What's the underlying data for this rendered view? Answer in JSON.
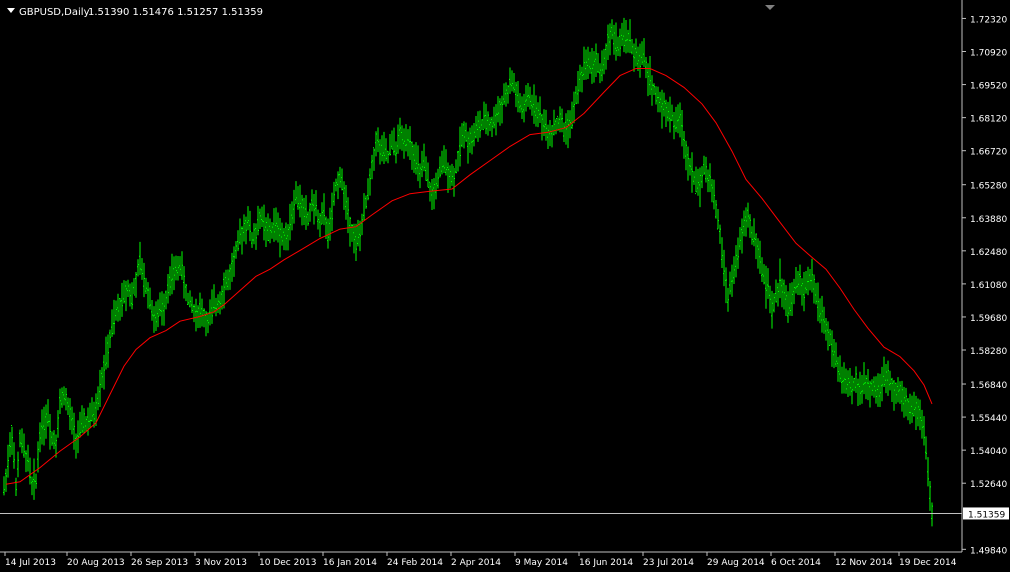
{
  "header": {
    "symbol_label": "GBPUSD,Daily",
    "ohlc_text": "1.51390 1.51476 1.51257 1.51359"
  },
  "colors": {
    "background": "#000000",
    "bars": "#00ff00",
    "moving_average": "#ff0000",
    "axis": "#c0c0c0",
    "text": "#ffffff",
    "price_line": "#c0c0c0"
  },
  "chart_data": {
    "type": "line",
    "title": "GBPUSD,Daily",
    "xlabel": "",
    "ylabel": "",
    "ylim": [
      1.496,
      1.7272
    ],
    "grid": false,
    "current_price": "1.51359",
    "y_ticks": [
      "1.72320",
      "1.70920",
      "1.69520",
      "1.68120",
      "1.66720",
      "1.65280",
      "1.63880",
      "1.62480",
      "1.61080",
      "1.59680",
      "1.58280",
      "1.56840",
      "1.55440",
      "1.54040",
      "1.52640",
      "1.49840"
    ],
    "x_ticks": [
      "14 Jul 2013",
      "20 Aug 2013",
      "26 Sep 2013",
      "3 Nov 2013",
      "10 Dec 2013",
      "16 Jan 2014",
      "24 Feb 2014",
      "2 Apr 2014",
      "9 May 2014",
      "16 Jun 2014",
      "23 Jul 2014",
      "29 Aug 2014",
      "6 Oct 2014",
      "12 Nov 2014",
      "19 Dec 2014"
    ],
    "series": [
      {
        "style": "ohlc-bars",
        "x": [
          "14 Jul 2013",
          "20 Aug 2013",
          "26 Sep 2013",
          "3 Nov 2013",
          "10 Dec 2013",
          "16 Jan 2014",
          "24 Feb 2014",
          "2 Apr 2014",
          "9 May 2014",
          "16 Jun 2014",
          "23 Jul 2014",
          "29 Aug 2014",
          "6 Oct 2014",
          "12 Nov 2014",
          "19 Dec 2014"
        ],
        "values": [
          1.512,
          1.552,
          1.56,
          1.585,
          1.61,
          1.628,
          1.64,
          1.66,
          1.672,
          1.715,
          1.7,
          1.62,
          1.612,
          1.571,
          1.514
        ],
        "points": [
          [
            0,
            1.512
          ],
          [
            4,
            1.524
          ],
          [
            8,
            1.536
          ],
          [
            12,
            1.548
          ],
          [
            16,
            1.524
          ],
          [
            20,
            1.545
          ],
          [
            24,
            1.54
          ],
          [
            28,
            1.536
          ],
          [
            32,
            1.525
          ],
          [
            36,
            1.528
          ],
          [
            40,
            1.548
          ],
          [
            44,
            1.552
          ],
          [
            48,
            1.555
          ],
          [
            52,
            1.546
          ],
          [
            56,
            1.545
          ],
          [
            60,
            1.56
          ],
          [
            64,
            1.565
          ],
          [
            68,
            1.558
          ],
          [
            72,
            1.552
          ],
          [
            76,
            1.545
          ],
          [
            80,
            1.548
          ],
          [
            84,
            1.553
          ],
          [
            88,
            1.552
          ],
          [
            92,
            1.555
          ],
          [
            96,
            1.558
          ],
          [
            100,
            1.568
          ],
          [
            104,
            1.575
          ],
          [
            108,
            1.583
          ],
          [
            112,
            1.592
          ],
          [
            116,
            1.598
          ],
          [
            120,
            1.602
          ],
          [
            124,
            1.606
          ],
          [
            128,
            1.61
          ],
          [
            132,
            1.605
          ],
          [
            136,
            1.612
          ],
          [
            140,
            1.62
          ],
          [
            144,
            1.612
          ],
          [
            148,
            1.608
          ],
          [
            152,
            1.6
          ],
          [
            156,
            1.595
          ],
          [
            160,
            1.6
          ],
          [
            164,
            1.602
          ],
          [
            168,
            1.61
          ],
          [
            172,
            1.614
          ],
          [
            176,
            1.616
          ],
          [
            180,
            1.62
          ],
          [
            184,
            1.612
          ],
          [
            188,
            1.604
          ],
          [
            192,
            1.602
          ],
          [
            196,
            1.598
          ],
          [
            200,
            1.6
          ],
          [
            204,
            1.597
          ],
          [
            208,
            1.594
          ],
          [
            212,
            1.6
          ],
          [
            216,
            1.602
          ],
          [
            220,
            1.605
          ],
          [
            224,
            1.61
          ],
          [
            228,
            1.612
          ],
          [
            232,
            1.618
          ],
          [
            236,
            1.624
          ],
          [
            240,
            1.63
          ],
          [
            244,
            1.635
          ],
          [
            248,
            1.638
          ],
          [
            252,
            1.63
          ],
          [
            256,
            1.632
          ],
          [
            260,
            1.64
          ],
          [
            264,
            1.636
          ],
          [
            268,
            1.632
          ],
          [
            272,
            1.634
          ],
          [
            276,
            1.636
          ],
          [
            280,
            1.632
          ],
          [
            284,
            1.63
          ],
          [
            288,
            1.634
          ],
          [
            292,
            1.64
          ],
          [
            296,
            1.648
          ],
          [
            300,
            1.645
          ],
          [
            304,
            1.642
          ],
          [
            308,
            1.638
          ],
          [
            312,
            1.646
          ],
          [
            316,
            1.642
          ],
          [
            320,
            1.637
          ],
          [
            324,
            1.64
          ],
          [
            328,
            1.632
          ],
          [
            332,
            1.64
          ],
          [
            336,
            1.652
          ],
          [
            340,
            1.657
          ],
          [
            344,
            1.65
          ],
          [
            348,
            1.64
          ],
          [
            352,
            1.634
          ],
          [
            356,
            1.628
          ],
          [
            360,
            1.632
          ],
          [
            364,
            1.64
          ],
          [
            368,
            1.65
          ],
          [
            372,
            1.66
          ],
          [
            376,
            1.672
          ],
          [
            380,
            1.668
          ],
          [
            384,
            1.666
          ],
          [
            388,
            1.665
          ],
          [
            392,
            1.67
          ],
          [
            396,
            1.668
          ],
          [
            400,
            1.674
          ],
          [
            404,
            1.67
          ],
          [
            408,
            1.674
          ],
          [
            412,
            1.668
          ],
          [
            416,
            1.662
          ],
          [
            420,
            1.658
          ],
          [
            424,
            1.661
          ],
          [
            428,
            1.654
          ],
          [
            432,
            1.648
          ],
          [
            436,
            1.652
          ],
          [
            440,
            1.658
          ],
          [
            444,
            1.662
          ],
          [
            448,
            1.66
          ],
          [
            452,
            1.655
          ],
          [
            456,
            1.66
          ],
          [
            460,
            1.668
          ],
          [
            464,
            1.676
          ],
          [
            468,
            1.672
          ],
          [
            472,
            1.672
          ],
          [
            476,
            1.676
          ],
          [
            480,
            1.678
          ],
          [
            484,
            1.679
          ],
          [
            488,
            1.68
          ],
          [
            492,
            1.678
          ],
          [
            496,
            1.682
          ],
          [
            500,
            1.685
          ],
          [
            504,
            1.69
          ],
          [
            508,
            1.692
          ],
          [
            512,
            1.697
          ],
          [
            516,
            1.692
          ],
          [
            520,
            1.686
          ],
          [
            524,
            1.684
          ],
          [
            528,
            1.69
          ],
          [
            532,
            1.688
          ],
          [
            536,
            1.685
          ],
          [
            540,
            1.682
          ],
          [
            544,
            1.678
          ],
          [
            548,
            1.675
          ],
          [
            552,
            1.676
          ],
          [
            556,
            1.678
          ],
          [
            560,
            1.68
          ],
          [
            564,
            1.676
          ],
          [
            568,
            1.678
          ],
          [
            572,
            1.68
          ],
          [
            576,
            1.69
          ],
          [
            580,
            1.698
          ],
          [
            584,
            1.702
          ],
          [
            588,
            1.706
          ],
          [
            592,
            1.703
          ],
          [
            596,
            1.706
          ],
          [
            600,
            1.7
          ],
          [
            604,
            1.704
          ],
          [
            608,
            1.714
          ],
          [
            612,
            1.717
          ],
          [
            616,
            1.712
          ],
          [
            620,
            1.713
          ],
          [
            624,
            1.714
          ],
          [
            628,
            1.716
          ],
          [
            632,
            1.71
          ],
          [
            636,
            1.708
          ],
          [
            640,
            1.705
          ],
          [
            644,
            1.707
          ],
          [
            648,
            1.698
          ],
          [
            652,
            1.696
          ],
          [
            656,
            1.69
          ],
          [
            660,
            1.688
          ],
          [
            664,
            1.686
          ],
          [
            668,
            1.684
          ],
          [
            672,
            1.682
          ],
          [
            676,
            1.678
          ],
          [
            680,
            1.682
          ],
          [
            684,
            1.67
          ],
          [
            688,
            1.664
          ],
          [
            692,
            1.66
          ],
          [
            696,
            1.652
          ],
          [
            700,
            1.654
          ],
          [
            704,
            1.66
          ],
          [
            708,
            1.656
          ],
          [
            712,
            1.652
          ],
          [
            716,
            1.642
          ],
          [
            720,
            1.632
          ],
          [
            724,
            1.616
          ],
          [
            728,
            1.606
          ],
          [
            732,
            1.612
          ],
          [
            736,
            1.62
          ],
          [
            740,
            1.628
          ],
          [
            744,
            1.635
          ],
          [
            748,
            1.64
          ],
          [
            752,
            1.632
          ],
          [
            756,
            1.63
          ],
          [
            760,
            1.62
          ],
          [
            764,
            1.614
          ],
          [
            768,
            1.608
          ],
          [
            772,
            1.6
          ],
          [
            776,
            1.605
          ],
          [
            780,
            1.612
          ],
          [
            784,
            1.608
          ],
          [
            788,
            1.6
          ],
          [
            792,
            1.605
          ],
          [
            796,
            1.61
          ],
          [
            800,
            1.612
          ],
          [
            804,
            1.608
          ],
          [
            808,
            1.61
          ],
          [
            812,
            1.614
          ],
          [
            816,
            1.606
          ],
          [
            820,
            1.6
          ],
          [
            824,
            1.596
          ],
          [
            828,
            1.59
          ],
          [
            832,
            1.584
          ],
          [
            836,
            1.578
          ],
          [
            840,
            1.573
          ],
          [
            844,
            1.57
          ],
          [
            848,
            1.568
          ],
          [
            852,
            1.566
          ],
          [
            856,
            1.57
          ],
          [
            860,
            1.566
          ],
          [
            864,
            1.57
          ],
          [
            868,
            1.566
          ],
          [
            872,
            1.568
          ],
          [
            876,
            1.565
          ],
          [
            880,
            1.566
          ],
          [
            884,
            1.57
          ],
          [
            888,
            1.572
          ],
          [
            892,
            1.568
          ],
          [
            896,
            1.566
          ],
          [
            900,
            1.565
          ],
          [
            904,
            1.562
          ],
          [
            908,
            1.56
          ],
          [
            912,
            1.558
          ],
          [
            916,
            1.558
          ],
          [
            920,
            1.555
          ],
          [
            924,
            1.548
          ],
          [
            928,
            1.53
          ],
          [
            932,
            1.514
          ]
        ]
      },
      {
        "style": "moving-average",
        "points": [
          [
            6,
            1.526
          ],
          [
            20,
            1.527
          ],
          [
            40,
            1.533
          ],
          [
            60,
            1.54
          ],
          [
            80,
            1.546
          ],
          [
            96,
            1.552
          ],
          [
            110,
            1.564
          ],
          [
            124,
            1.576
          ],
          [
            136,
            1.583
          ],
          [
            150,
            1.588
          ],
          [
            166,
            1.591
          ],
          [
            180,
            1.595
          ],
          [
            200,
            1.597
          ],
          [
            214,
            1.599
          ],
          [
            224,
            1.602
          ],
          [
            240,
            1.608
          ],
          [
            256,
            1.614
          ],
          [
            270,
            1.617
          ],
          [
            284,
            1.621
          ],
          [
            300,
            1.625
          ],
          [
            320,
            1.63
          ],
          [
            340,
            1.634
          ],
          [
            356,
            1.635
          ],
          [
            372,
            1.64
          ],
          [
            392,
            1.646
          ],
          [
            410,
            1.649
          ],
          [
            430,
            1.65
          ],
          [
            452,
            1.651
          ],
          [
            470,
            1.657
          ],
          [
            490,
            1.663
          ],
          [
            510,
            1.669
          ],
          [
            530,
            1.674
          ],
          [
            548,
            1.675
          ],
          [
            566,
            1.677
          ],
          [
            584,
            1.683
          ],
          [
            604,
            1.692
          ],
          [
            620,
            1.699
          ],
          [
            636,
            1.702
          ],
          [
            650,
            1.702
          ],
          [
            666,
            1.699
          ],
          [
            684,
            1.694
          ],
          [
            702,
            1.687
          ],
          [
            716,
            1.679
          ],
          [
            732,
            1.667
          ],
          [
            746,
            1.655
          ],
          [
            762,
            1.647
          ],
          [
            778,
            1.638
          ],
          [
            796,
            1.628
          ],
          [
            812,
            1.622
          ],
          [
            826,
            1.617
          ],
          [
            840,
            1.609
          ],
          [
            854,
            1.6
          ],
          [
            868,
            1.592
          ],
          [
            884,
            1.584
          ],
          [
            900,
            1.58
          ],
          [
            914,
            1.574
          ],
          [
            924,
            1.568
          ],
          [
            932,
            1.56
          ]
        ]
      }
    ]
  }
}
